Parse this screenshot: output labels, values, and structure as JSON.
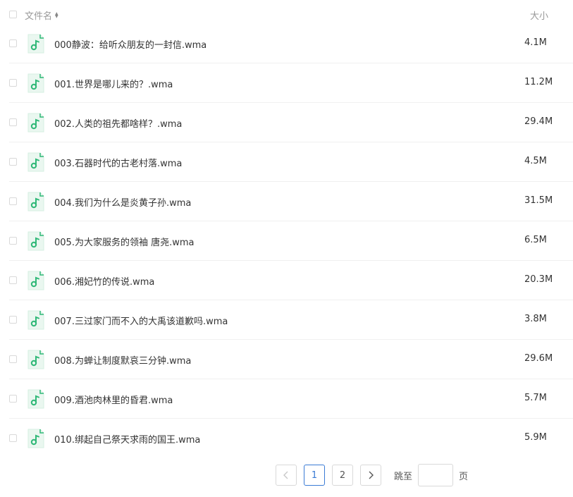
{
  "header": {
    "name_label": "文件名",
    "size_label": "大小"
  },
  "files": [
    {
      "name": "000静波：给听众朋友的一封信.wma",
      "size": "4.1M"
    },
    {
      "name": "001.世界是哪儿来的？.wma",
      "size": "11.2M"
    },
    {
      "name": "002.人类的祖先都啥样？.wma",
      "size": "29.4M"
    },
    {
      "name": "003.石器时代的古老村落.wma",
      "size": "4.5M"
    },
    {
      "name": "004.我们为什么是炎黄子孙.wma",
      "size": "31.5M"
    },
    {
      "name": "005.为大家服务的领袖 唐尧.wma",
      "size": "6.5M"
    },
    {
      "name": "006.湘妃竹的传说.wma",
      "size": "20.3M"
    },
    {
      "name": "007.三过家门而不入的大禹该道歉吗.wma",
      "size": "3.8M"
    },
    {
      "name": "008.为蝉让制度默哀三分钟.wma",
      "size": "29.6M"
    },
    {
      "name": "009.酒池肉林里的昏君.wma",
      "size": "5.7M"
    },
    {
      "name": "010.绑起自己祭天求雨的国王.wma",
      "size": "5.9M"
    }
  ],
  "pagination": {
    "prev_icon": "chevron-left-icon",
    "next_icon": "chevron-right-icon",
    "pages": [
      "1",
      "2"
    ],
    "current_page": "1",
    "jump_label": "跳至",
    "jump_value": "",
    "page_unit": "页"
  },
  "colors": {
    "audio_icon": "#2fb877",
    "accent": "#3a7bd5"
  }
}
